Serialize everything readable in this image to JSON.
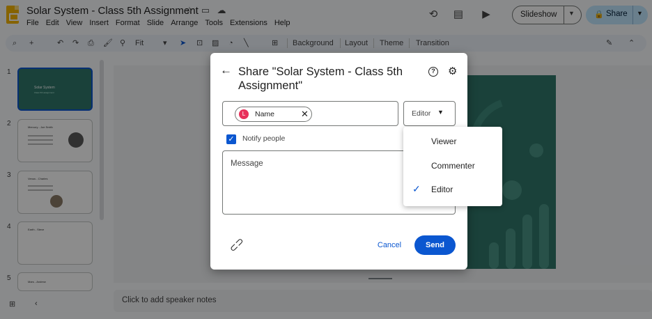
{
  "app": {
    "title": "Solar System - Class  5th Assignment",
    "menu": [
      "File",
      "Edit",
      "View",
      "Insert",
      "Format",
      "Slide",
      "Arrange",
      "Tools",
      "Extensions",
      "Help"
    ],
    "slideshow_label": "Slideshow",
    "share_label": "Share"
  },
  "toolbar": {
    "zoom": "Fit",
    "background": "Background",
    "layout": "Layout",
    "theme": "Theme",
    "transition": "Transition"
  },
  "filmstrip": {
    "slides": [
      {
        "num": "1",
        "title": "Solar System",
        "subtitle": "Class 5th assignment"
      },
      {
        "num": "2",
        "title": "Mercury - Joe Smith"
      },
      {
        "num": "3",
        "title": "Venus - Charles"
      },
      {
        "num": "4",
        "title": "Earth - Steve"
      },
      {
        "num": "5",
        "title": "Mars - Andrew"
      }
    ]
  },
  "notes": {
    "placeholder": "Click to add speaker notes"
  },
  "dialog": {
    "title": "Share \"Solar System - Class 5th Assignment\"",
    "chip": {
      "initial": "L",
      "name": "Name"
    },
    "role": "Editor",
    "notify_label": "Notify people",
    "message_placeholder": "Message",
    "cancel_label": "Cancel",
    "send_label": "Send"
  },
  "role_menu": {
    "items": [
      {
        "label": "Viewer",
        "selected": false
      },
      {
        "label": "Commenter",
        "selected": false
      },
      {
        "label": "Editor",
        "selected": true
      }
    ]
  },
  "colors": {
    "accent": "#0b57d0",
    "slide_bg": "#30776a",
    "share_bg": "#c2e7ff",
    "avatar": "#e8315b"
  }
}
